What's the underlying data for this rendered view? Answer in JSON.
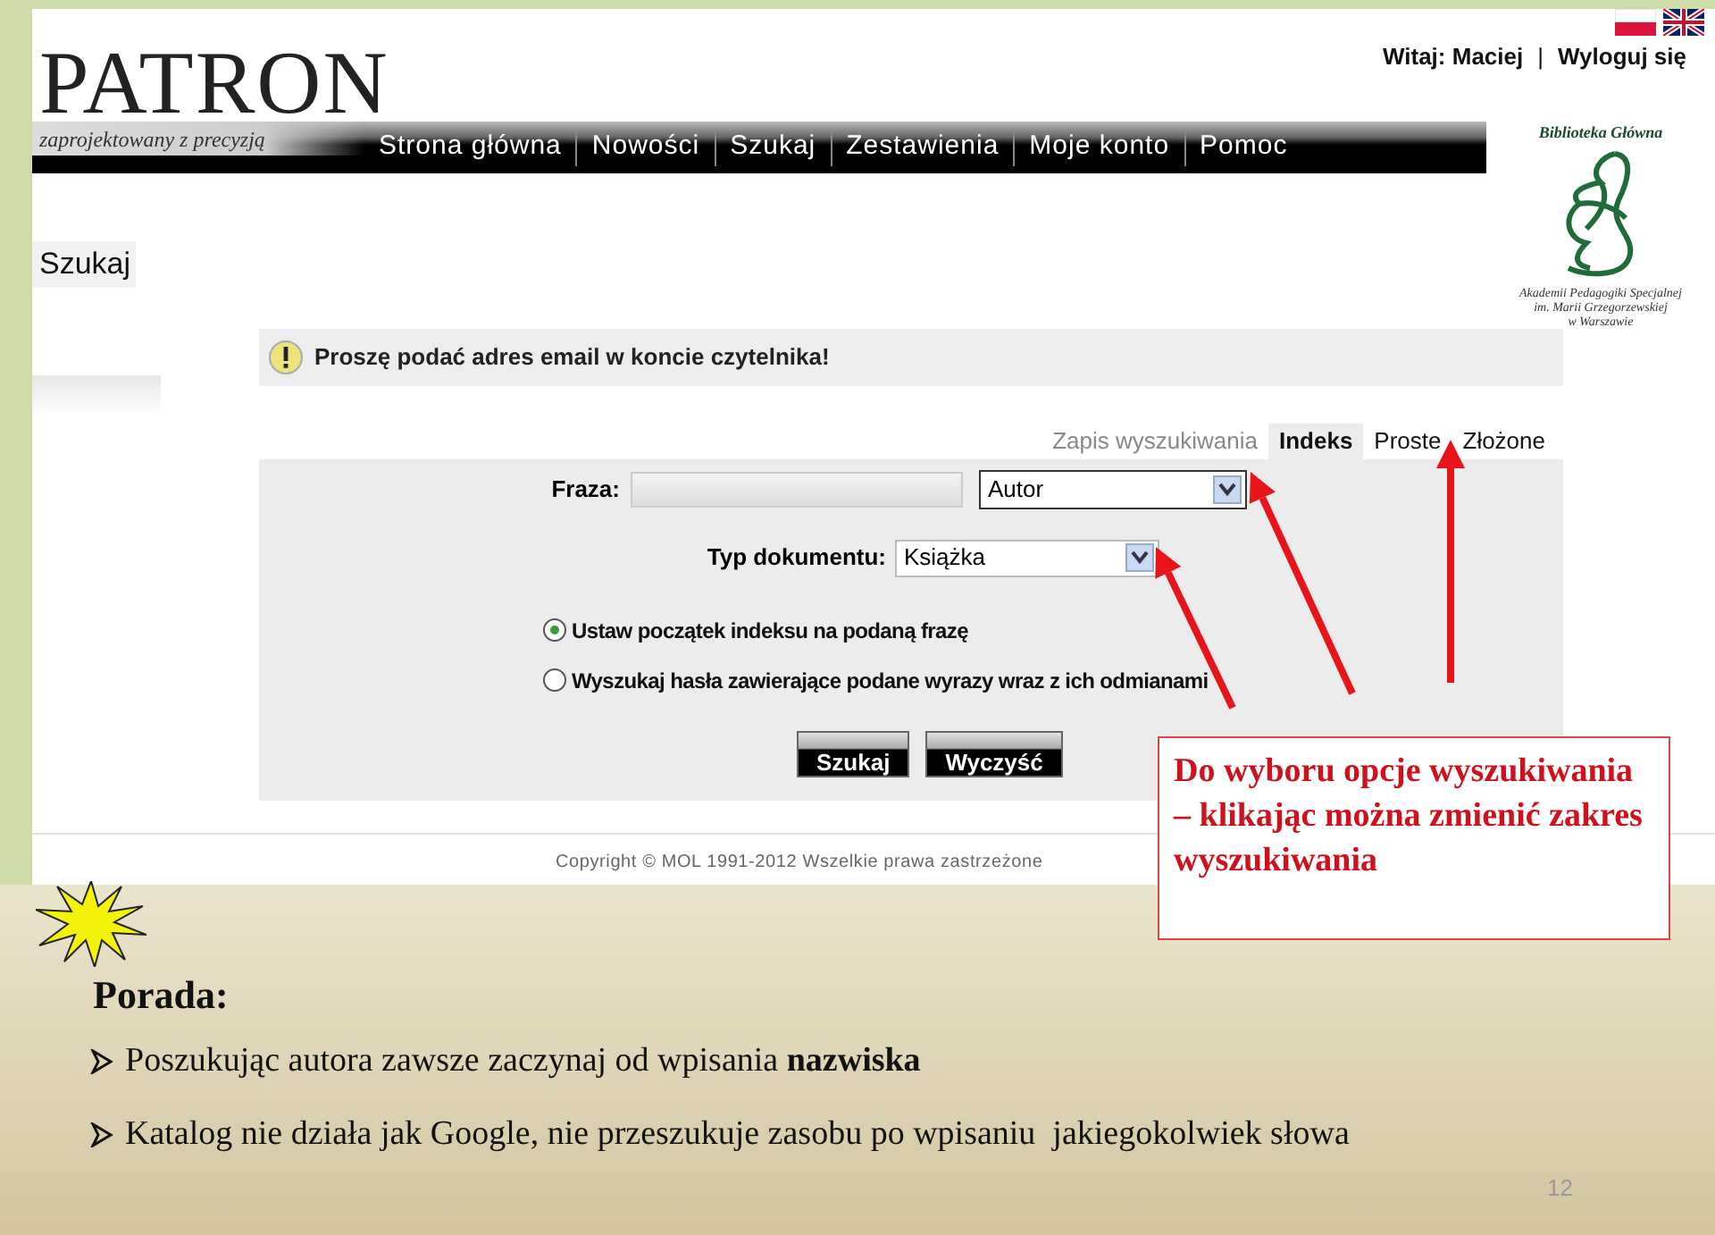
{
  "header": {
    "logo_title": "PATRON",
    "logo_tagline": "zaprojektowany z precyzją",
    "greeting": "Witaj: Maciej",
    "separator": "|",
    "logout": "Wyloguj się"
  },
  "nav": [
    {
      "label": "Strona główna"
    },
    {
      "label": "Nowości"
    },
    {
      "label": "Szukaj"
    },
    {
      "label": "Zestawienia"
    },
    {
      "label": "Moje konto"
    },
    {
      "label": "Pomoc"
    }
  ],
  "library_logo": {
    "title": "Biblioteka Główna",
    "caption_lines": [
      "Akademii Pedagogiki Specjalnej",
      "im. Marii Grzegorzewskiej",
      "w Warszawie"
    ]
  },
  "page_title": "Szukaj",
  "alert": "Proszę podać adres email w koncie czytelnika!",
  "search_tabs": [
    {
      "label": "Zapis wyszukiwania",
      "selected": false,
      "disabled": true
    },
    {
      "label": "Indeks",
      "selected": true,
      "disabled": false
    },
    {
      "label": "Proste",
      "selected": false,
      "disabled": false
    },
    {
      "label": "Złożone",
      "selected": false,
      "disabled": false
    }
  ],
  "form": {
    "phrase_label": "Fraza:",
    "field_select": "Autor",
    "doctype_label": "Typ dokumentu:",
    "doctype_select": "Książka",
    "options": [
      {
        "label": "Ustaw początek indeksu na podaną frazę",
        "selected": true
      },
      {
        "label": "Wyszukaj hasła zawierające podane wyrazy wraz z ich odmianami",
        "selected": false
      }
    ],
    "buttons": [
      "Szukaj",
      "Wyczyść"
    ]
  },
  "copyright": "Copyright © MOL 1991-2012 Wszelkie prawa zastrzeżone",
  "callout": "Do wyboru opcje wyszukiwania – klikając można zmienić zakres wyszukiwania",
  "tip": {
    "title": "Porada:",
    "bullets": [
      "Poszukując autora zawsze zaczynaj od wpisania **nazwiska**",
      "Katalog nie działa jak Google, nie przeszukuje zasobu po wpisaniu  jakiegokolwiek słowa"
    ]
  },
  "slide_number": "12"
}
